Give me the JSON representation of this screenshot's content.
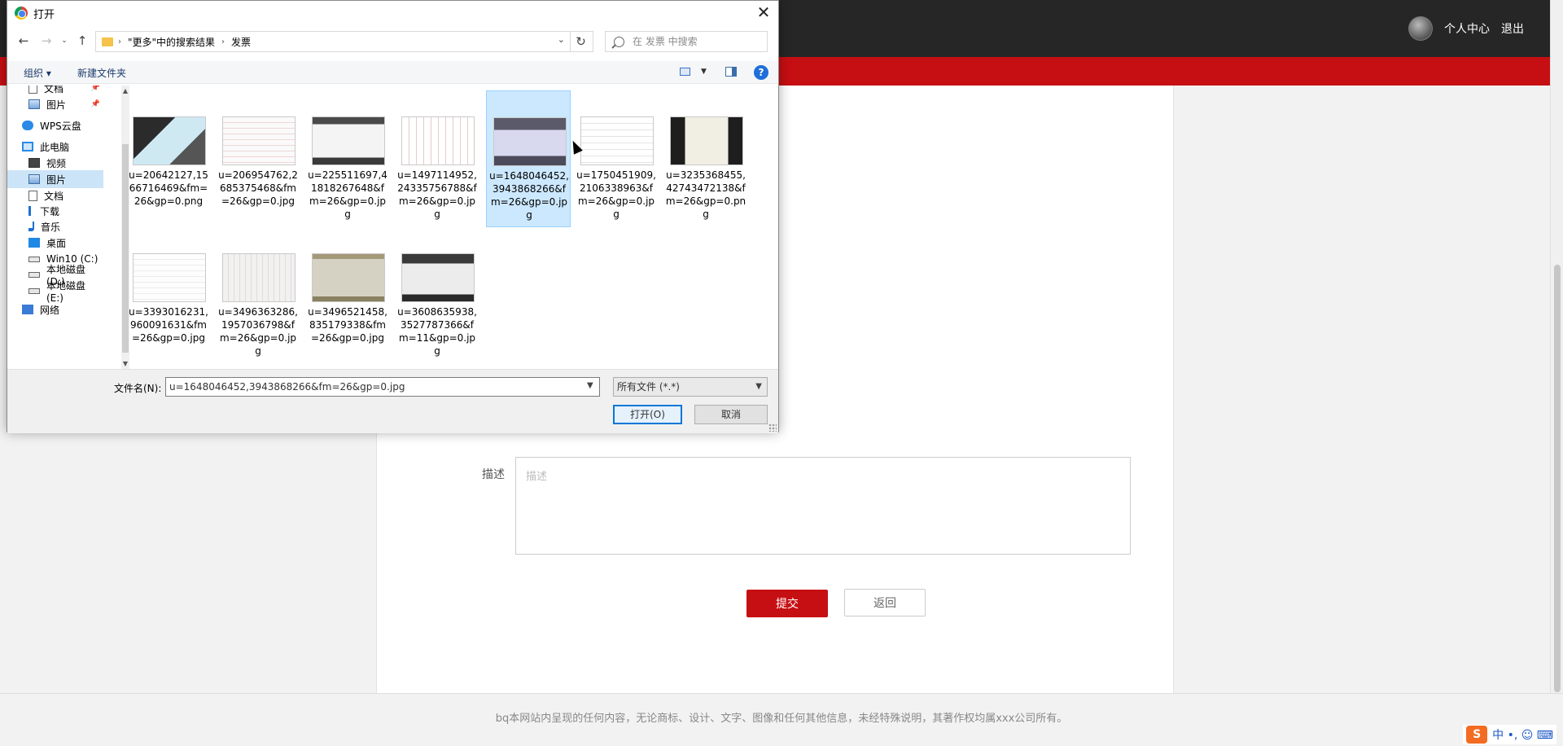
{
  "webpage": {
    "user_center": "个人中心",
    "logout": "退出",
    "desc_label": "描述",
    "desc_placeholder": "描述",
    "submit": "提交",
    "back": "返回",
    "footer": "bq本网站内呈现的任何内容，无论商标、设计、文字、图像和任何其他信息，未经特殊说明，其著作权均属xxx公司所有。",
    "ime": "中 •, ☺ ⌨"
  },
  "dialog": {
    "title": "打开",
    "breadcrumb": [
      "\"更多\"中的搜索结果",
      "发票"
    ],
    "search_placeholder": "在 发票 中搜索",
    "organize": "组织 ▾",
    "new_folder": "新建文件夹",
    "sidebar": [
      {
        "label": "文档",
        "icon": "document-icon",
        "pinned": true
      },
      {
        "label": "图片",
        "icon": "picture-icon",
        "pinned": true
      },
      {
        "label": "WPS云盘",
        "icon": "cloud-icon"
      },
      {
        "label": "此电脑",
        "icon": "computer-icon"
      },
      {
        "label": "视频",
        "icon": "video-icon"
      },
      {
        "label": "图片",
        "icon": "picture-icon",
        "selected": true
      },
      {
        "label": "文档",
        "icon": "document-icon"
      },
      {
        "label": "下载",
        "icon": "download-icon"
      },
      {
        "label": "音乐",
        "icon": "music-icon"
      },
      {
        "label": "桌面",
        "icon": "desktop-icon"
      },
      {
        "label": "Win10 (C:)",
        "icon": "drive-icon"
      },
      {
        "label": "本地磁盘 (D:)",
        "icon": "drive-icon"
      },
      {
        "label": "本地磁盘 (E:)",
        "icon": "drive-icon"
      },
      {
        "label": "网络",
        "icon": "network-icon"
      }
    ],
    "files": [
      {
        "name": "u=20642127,1566716469&fm=26&gp=0.png"
      },
      {
        "name": "u=206954762,2685375468&fm=26&gp=0.jpg"
      },
      {
        "name": "u=225511697,41818267648&fm=26&gp=0.jpg"
      },
      {
        "name": "u=1497114952,24335756788&fm=26&gp=0.jpg"
      },
      {
        "name": "u=1648046452,3943868266&fm=26&gp=0.jpg",
        "selected": true
      },
      {
        "name": "u=1750451909,2106338963&fm=26&gp=0.jpg"
      },
      {
        "name": "u=3235368455,42743472138&fm=26&gp=0.png"
      },
      {
        "name": "u=3393016231,960091631&fm=26&gp=0.jpg"
      },
      {
        "name": "u=3496363286,1957036798&fm=26&gp=0.jpg"
      },
      {
        "name": "u=3496521458,835179338&fm=26&gp=0.jpg"
      },
      {
        "name": "u=3608635938,3527787366&fm=11&gp=0.jpg"
      }
    ],
    "filename_label": "文件名(N):",
    "filename_value": "u=1648046452,3943868266&fm=26&gp=0.jpg",
    "file_type": "所有文件 (*.*)",
    "open": "打开(O)",
    "cancel": "取消"
  },
  "colors": {
    "brand_red": "#c60f13",
    "topbar": "#262626",
    "selection": "#cce8ff"
  }
}
